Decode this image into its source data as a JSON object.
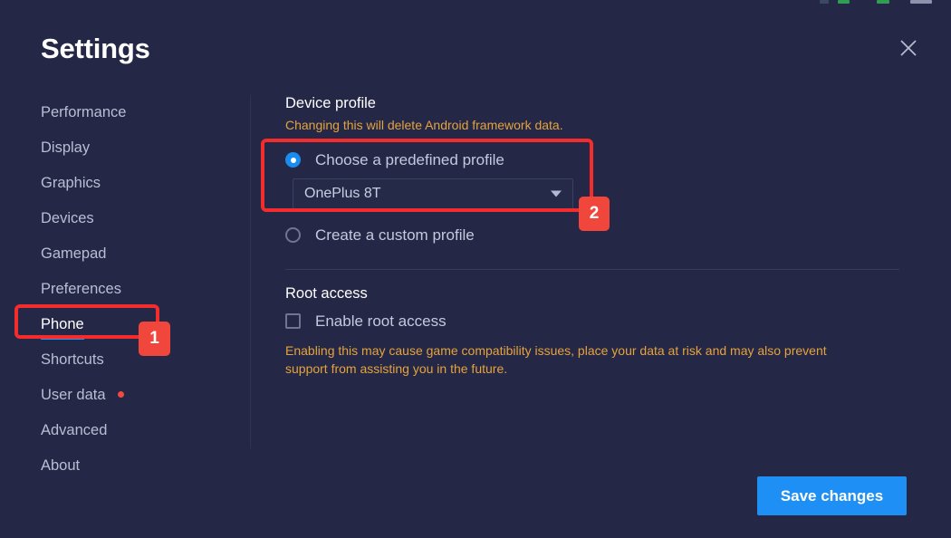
{
  "window": {
    "title": "Settings",
    "close_icon": "close-icon"
  },
  "sidebar": {
    "items": [
      {
        "label": "Performance",
        "active": false,
        "dot": false
      },
      {
        "label": "Display",
        "active": false,
        "dot": false
      },
      {
        "label": "Graphics",
        "active": false,
        "dot": false
      },
      {
        "label": "Devices",
        "active": false,
        "dot": false
      },
      {
        "label": "Gamepad",
        "active": false,
        "dot": false
      },
      {
        "label": "Preferences",
        "active": false,
        "dot": false
      },
      {
        "label": "Phone",
        "active": true,
        "dot": false
      },
      {
        "label": "Shortcuts",
        "active": false,
        "dot": false
      },
      {
        "label": "User data",
        "active": false,
        "dot": true
      },
      {
        "label": "Advanced",
        "active": false,
        "dot": false
      },
      {
        "label": "About",
        "active": false,
        "dot": false
      }
    ]
  },
  "main": {
    "device_profile": {
      "title": "Device profile",
      "note": "Changing this will delete Android framework data.",
      "predefined_option_label": "Choose a predefined profile",
      "predefined_selected": true,
      "dropdown_value": "OnePlus 8T",
      "custom_option_label": "Create a custom profile",
      "custom_selected": false
    },
    "root_access": {
      "title": "Root access",
      "checkbox_label": "Enable root access",
      "checkbox_checked": false,
      "warning": "Enabling this may cause game compatibility issues, place your data at risk and may also prevent support from assisting you in the future."
    }
  },
  "footer": {
    "save_label": "Save changes"
  },
  "annotations": {
    "badge_1": "1",
    "badge_2": "2"
  },
  "colors": {
    "background": "#242745",
    "accent_blue": "#1e90f5",
    "warning_orange": "#e5a33e",
    "annotation_red": "#f42c2c",
    "notification_dot": "#f04b3c"
  }
}
